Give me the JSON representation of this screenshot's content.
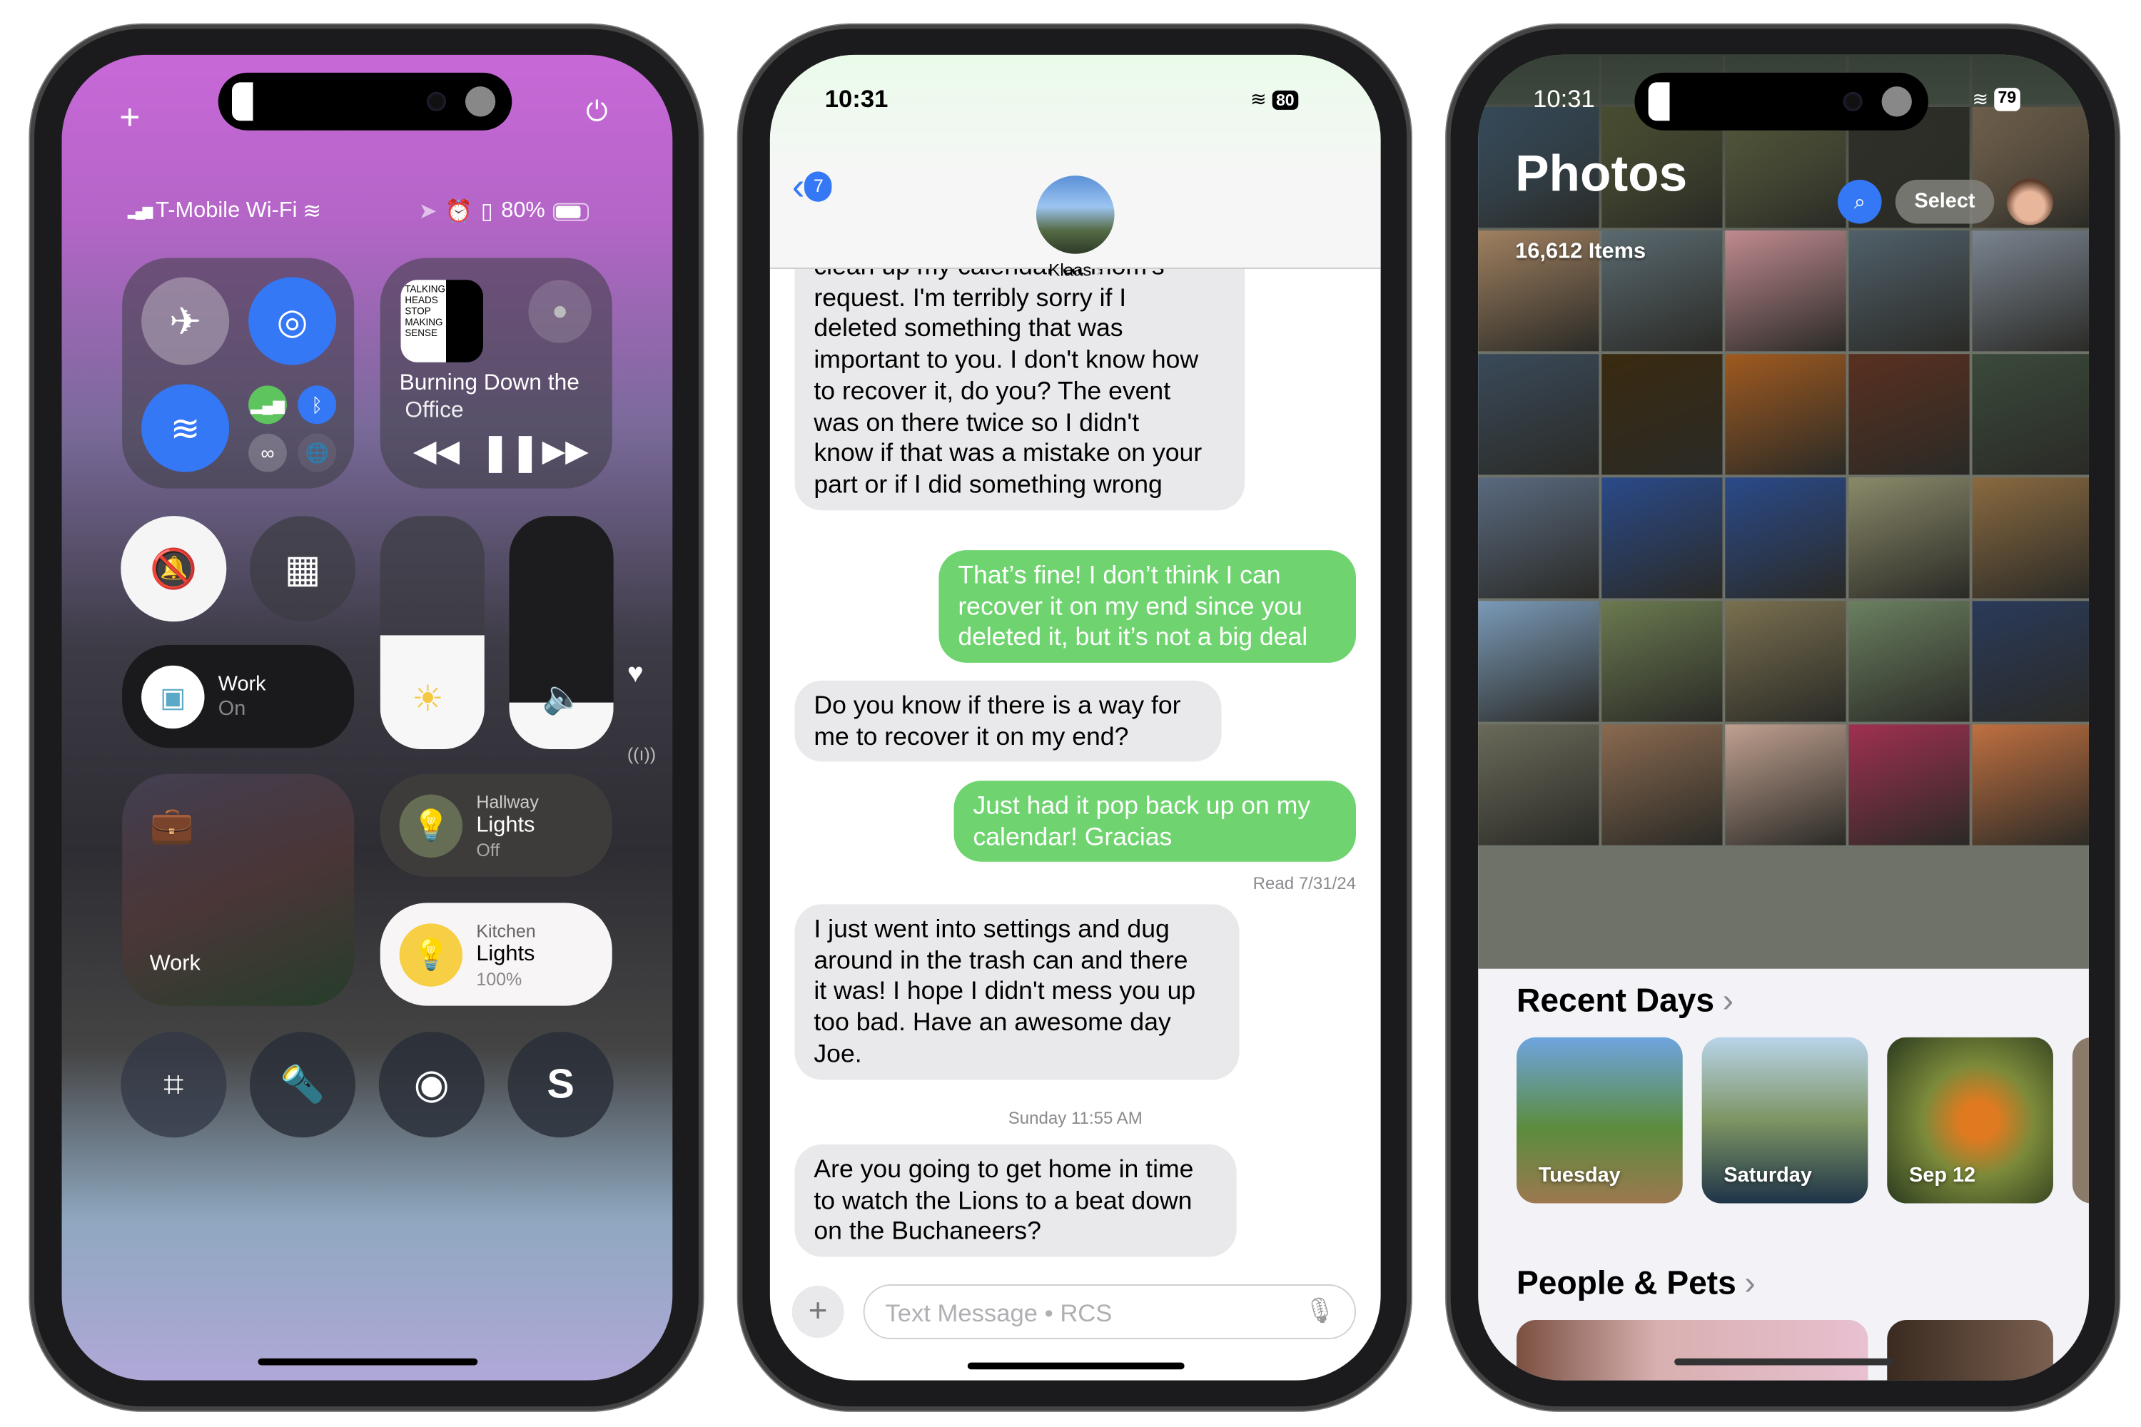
{
  "control_center": {
    "carrier": "T-Mobile Wi-Fi",
    "battery": "80%",
    "now_playing": {
      "title_line1": "Burning Down the",
      "title_line2": "Office",
      "album_art_text": "TALKING HEADS STOP MAKING SENSE"
    },
    "focus": {
      "label": "Work",
      "status": "On"
    },
    "work_tile_label": "Work",
    "hallway": {
      "room": "Hallway",
      "name": "Lights",
      "status": "Off"
    },
    "kitchen": {
      "room": "Kitchen",
      "name": "Lights",
      "status": "100%"
    },
    "brightness_level": 0.49,
    "volume_level": 0.1,
    "icons": [
      "plus-icon",
      "power-icon",
      "airplane-icon",
      "airdrop-icon",
      "wifi-icon",
      "cellular-icon",
      "bluetooth-icon",
      "personal-hotspot-icon",
      "vpn-icon",
      "bell-slash-icon",
      "calculator-icon",
      "sun-icon",
      "speaker-icon",
      "briefcase-icon",
      "lightbulb-icon",
      "qr-code-icon",
      "flashlight-icon",
      "record-icon",
      "shazam-icon",
      "heart-icon",
      "antenna-icon",
      "rewind-icon",
      "pause-icon",
      "fast-forward-icon"
    ],
    "accent": "#3478f6"
  },
  "messages": {
    "time": "10:31",
    "battery": "80",
    "back_badge": "7",
    "contact": "Klaas",
    "bubbles": [
      {
        "from": "them",
        "lines": [
          "clean up my calendar at mom's",
          "request. I'm terribly sorry if I",
          "deleted something that was",
          "important to you. I don't know how",
          "to recover it, do you? The event",
          "was on there twice so I didn't",
          "know if that was a mistake on your",
          "part or if I did something wrong"
        ]
      },
      {
        "from": "me",
        "lines": [
          "That’s fine! I don’t think I can",
          "recover it on my end since you",
          "deleted it, but it’s not a big deal"
        ]
      },
      {
        "from": "them",
        "lines": [
          "Do you know if there is a way for",
          "me to recover it on my end?"
        ]
      },
      {
        "from": "me",
        "lines": [
          "Just had it pop back up on my",
          "calendar! Gracias"
        ]
      },
      {
        "from": "them",
        "lines": [
          "I just went into settings and dug",
          "around in the trash can and there",
          "it was! I hope I didn't mess you up",
          "too bad. Have an awesome day",
          "Joe."
        ]
      },
      {
        "from": "them",
        "lines": [
          "Are you going to get home in time",
          "to watch the Lions to a beat down",
          "on the Buchaneers?"
        ]
      }
    ],
    "read_receipt": "Read 7/31/24",
    "timestamp": "Sunday 11:55 AM",
    "input_placeholder": "Text Message • RCS",
    "sent_color": "#6fd46f",
    "received_color": "#e9e9eb"
  },
  "photos": {
    "time": "10:31",
    "battery": "79",
    "title": "Photos",
    "count": "16,612 Items",
    "select_label": "Select",
    "recent_days_title": "Recent Days",
    "recent_days": [
      "Tuesday",
      "Saturday",
      "Sep 12"
    ],
    "people_title": "People & Pets"
  }
}
